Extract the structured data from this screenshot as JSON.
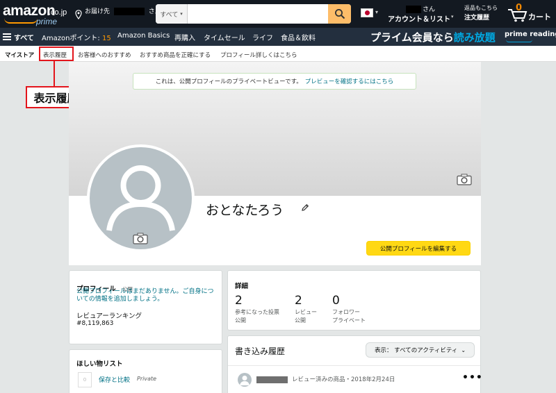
{
  "header": {
    "logo": {
      "brand": "amazon",
      "tld": ".co.jp",
      "sub": "prime"
    },
    "deliver": {
      "prefix": "お届け先",
      "suffix": "さん"
    },
    "search": {
      "category": "すべて",
      "placeholder": ""
    },
    "locale_flag": "jp-flag-icon",
    "account": {
      "line1_suffix": "さん",
      "line2": "アカウント＆リスト"
    },
    "orders": {
      "line1": "返品もこちら",
      "line2": "注文履歴"
    },
    "cart": {
      "count": "0",
      "label": "カート"
    }
  },
  "nav": {
    "all": "すべて",
    "points_label": "Amazonポイント:",
    "points_value": "15",
    "items": [
      "Amazon Basics",
      "再購入",
      "タイムセール",
      "ライフ",
      "食品＆飲料"
    ],
    "prime_banner_main": "プライム会員なら",
    "prime_banner_highlight": "読み放題",
    "prime_reading": "prime reading"
  },
  "subnav": {
    "items": [
      "マイストア",
      "表示履歴",
      "お客様へのおすすめ",
      "おすすめ商品を正確にする",
      "プロフィール",
      "詳しくはこちら"
    ]
  },
  "annotation": {
    "label": "表示履歴",
    "color": "#e3141b"
  },
  "preview": {
    "text": "これは、公開プロフィールのプライベートビューです。",
    "link": "プレビューを確認するにはこちら"
  },
  "profile": {
    "name": "おとなたろう",
    "edit_button": "公開プロフィールを編集する"
  },
  "profile_card": {
    "title": "プロフィール",
    "visibility": "公開",
    "empty_message": "公開プロフィールはまだありません。ご自身についての情報を追加しましょう。",
    "ranking_label": "レビュアーランキング",
    "ranking_value": "#8,119,863"
  },
  "wishlist_card": {
    "title": "ほしい物リスト",
    "thumb_placeholder": "0",
    "list_name": "保存と比較",
    "list_privacy": "Private"
  },
  "details": {
    "title": "詳細",
    "stats": [
      {
        "value": "2",
        "label1": "参考になった投票",
        "label2": "公開"
      },
      {
        "value": "2",
        "label1": "レビュー",
        "label2": "公開"
      },
      {
        "value": "0",
        "label1": "フォロワー",
        "label2": "プライベート"
      }
    ]
  },
  "activity": {
    "title": "書き込み履歴",
    "filter": "表示：  すべてのアクティビティ",
    "items": [
      {
        "meta": "レビュー済みの商品・2018年2月24日"
      }
    ]
  },
  "colors": {
    "nav_dark": "#131921",
    "nav_secondary": "#232f3e",
    "accent_orange": "#ff9900",
    "search_button": "#febd69",
    "edit_button": "#ffd814",
    "link": "#007185"
  }
}
